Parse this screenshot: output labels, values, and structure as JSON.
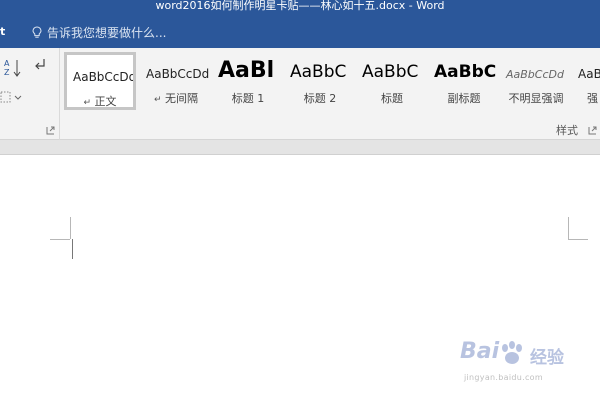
{
  "window": {
    "title": "word2016如何制作明星卡贴——林心如十五.docx - Word",
    "tab_partial": "t"
  },
  "tell_me": {
    "placeholder": "告诉我您想要做什么...",
    "icon": "lightbulb-icon"
  },
  "paragraph_group": {
    "sort_icon": "sort-az-icon",
    "show_marks_icon": "pilcrow-icon",
    "borders_icon": "borders-icon",
    "launcher_icon": "dialog-launcher-icon"
  },
  "styles": {
    "group_label": "样式",
    "items": [
      {
        "sample": "AaBbCcDd",
        "label": "正文",
        "mark": "↵",
        "selected": true
      },
      {
        "sample": "AaBbCcDd",
        "label": "无间隔",
        "mark": "↵",
        "selected": false
      },
      {
        "sample": "AaBl",
        "label": "标题 1",
        "selected": false
      },
      {
        "sample": "AaBbC",
        "label": "标题 2",
        "selected": false
      },
      {
        "sample": "AaBbC",
        "label": "标题",
        "selected": false
      },
      {
        "sample": "AaBbC",
        "label": "副标题",
        "selected": false
      },
      {
        "sample": "AaBbCcDd",
        "label": "不明显强调",
        "selected": false
      },
      {
        "sample": "AaBb",
        "label": "强",
        "selected": false
      }
    ],
    "launcher_icon": "dialog-launcher-icon"
  },
  "watermark": {
    "brand": "Bai",
    "brand_cn": "经验",
    "url": "jingyan.baidu.com"
  },
  "colors": {
    "titlebar": "#2b579a",
    "ribbon": "#f3f3f3",
    "document": "#ffffff"
  }
}
